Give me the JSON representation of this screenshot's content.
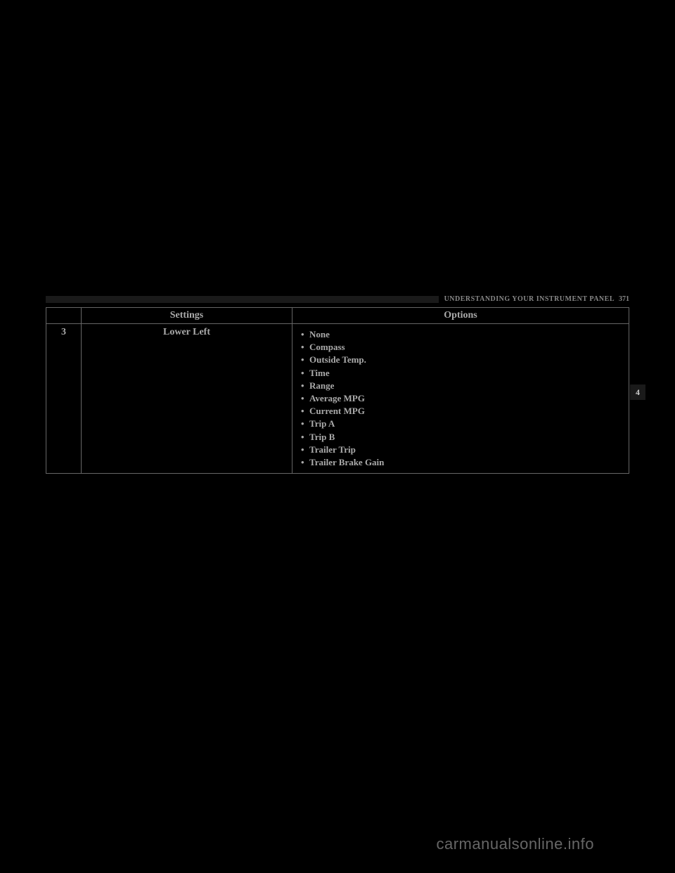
{
  "header": {
    "title": "UNDERSTANDING YOUR INSTRUMENT PANEL",
    "page_number": "371"
  },
  "section_tab": "4",
  "table": {
    "headers": {
      "col1": "",
      "col2": "Settings",
      "col3": "Options"
    },
    "row": {
      "number": "3",
      "setting": "Lower Left",
      "options": [
        "None",
        "Compass",
        "Outside Temp.",
        "Time",
        "Range",
        "Average MPG",
        "Current MPG",
        "Trip A",
        "Trip B",
        "Trailer Trip",
        "Trailer Brake Gain"
      ]
    }
  },
  "watermark": "carmanualsonline.info"
}
